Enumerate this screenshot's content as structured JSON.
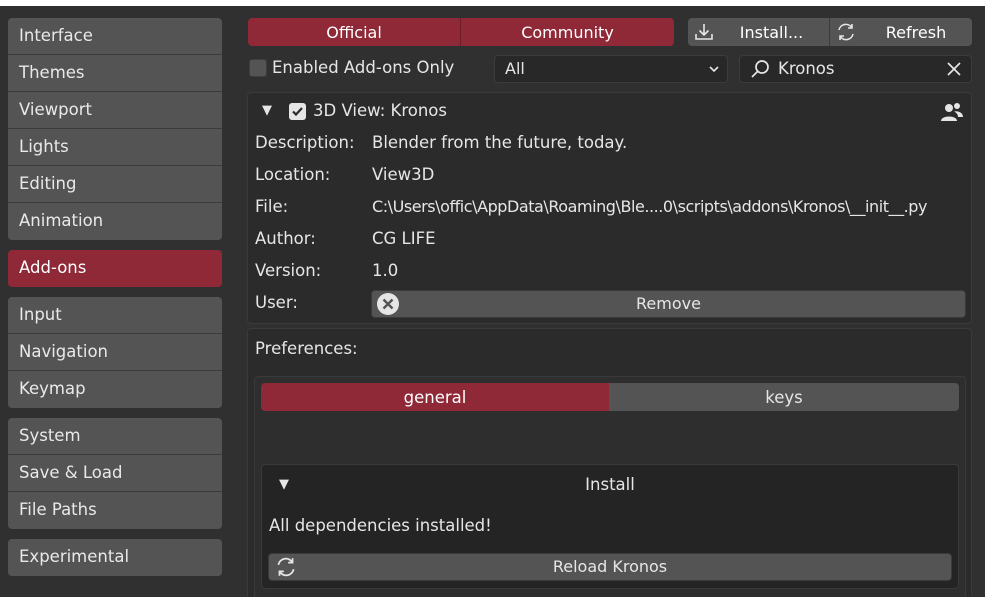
{
  "sidebar": {
    "groups": [
      {
        "items": [
          "Interface",
          "Themes",
          "Viewport",
          "Lights",
          "Editing",
          "Animation"
        ]
      },
      {
        "items": [
          "Add-ons"
        ],
        "active": true
      },
      {
        "items": [
          "Input",
          "Navigation",
          "Keymap"
        ]
      },
      {
        "items": [
          "System",
          "Save & Load",
          "File Paths"
        ]
      },
      {
        "items": [
          "Experimental"
        ]
      }
    ]
  },
  "toolbar": {
    "official_label": "Official",
    "community_label": "Community",
    "install_label": "Install...",
    "refresh_label": "Refresh",
    "enabled_only_label": "Enabled Add-ons Only",
    "category_value": "All",
    "search_value": "Kronos"
  },
  "addon": {
    "title": "3D View: Kronos",
    "fields": [
      {
        "label": "Description:",
        "value": "Blender from the future, today."
      },
      {
        "label": "Location:",
        "value": "View3D"
      },
      {
        "label": "File:",
        "value": "C:\\Users\\offic\\AppData\\Roaming\\Ble....0\\scripts\\addons\\Kronos\\__init__.py"
      },
      {
        "label": "Author:",
        "value": "CG LIFE"
      },
      {
        "label": "Version:",
        "value": "1.0"
      }
    ],
    "user_label": "User:",
    "remove_label": "Remove"
  },
  "preferences": {
    "label": "Preferences:",
    "tab_general": "general",
    "tab_keys": "keys",
    "install_header": "Install",
    "status_text": "All dependencies installed!",
    "reload_label": "Reload Kronos"
  },
  "colors": {
    "accent": "#8f2837",
    "background": "#303030",
    "button": "#545454"
  }
}
